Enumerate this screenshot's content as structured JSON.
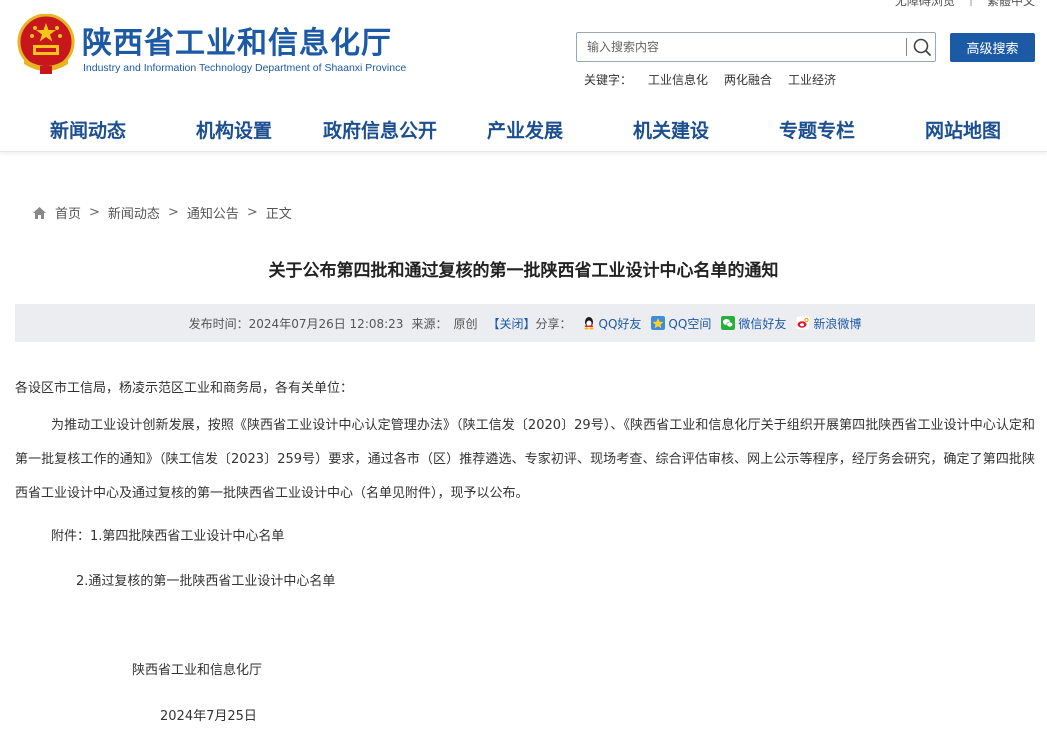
{
  "top_util": {
    "barrier_free": "无障碍浏览",
    "simplified": "繁體中文"
  },
  "site": {
    "title": "陕西省工业和信息化厅",
    "subtitle": "Industry and Information Technology Department of Shaanxi Province"
  },
  "search": {
    "placeholder": "输入搜索内容",
    "advanced_label": "高级搜索"
  },
  "keywords": {
    "label": "关键字：",
    "items": [
      "工业信息化",
      "两化融合",
      "工业经济"
    ]
  },
  "nav": {
    "items": [
      "新闻动态",
      "机构设置",
      "政府信息公开",
      "产业发展",
      "机关建设",
      "专题专栏",
      "网站地图"
    ]
  },
  "breadcrumb": {
    "items": [
      "首页",
      "新闻动态",
      "通知公告",
      "正文"
    ],
    "separator": ">"
  },
  "article": {
    "title": "关于公布第四批和通过复核的第一批陕西省工业设计中心名单的通知",
    "meta": {
      "publish_label": "发布时间：",
      "publish_time": "2024年07月26日 12:08:23",
      "source_label": "来源：",
      "source": "原创",
      "close": "【关闭】",
      "share_label": "分享：",
      "share": [
        "QQ好友",
        "QQ空间",
        "微信好友",
        "新浪微博"
      ]
    },
    "greeting": "各设区市工信局，杨凌示范区工业和商务局，各有关单位：",
    "body": "为推动工业设计创新发展，按照《陕西省工业设计中心认定管理办法》（陕工信发〔2020〕29号）、《陕西省工业和信息化厅关于组织开展第四批陕西省工业设计中心认定和第一批复核工作的通知》（陕工信发〔2023〕259号）要求，通过各市（区）推荐遴选、专家初评、现场考查、综合评估审核、网上公示等程序，经厅务会研究，确定了第四批陕西省工业设计中心及通过复核的第一批陕西省工业设计中心（名单见附件），现予以公布。",
    "attachment_1": "附件：1.第四批陕西省工业设计中心名单",
    "attachment_2": "2.通过复核的第一批陕西省工业设计中心名单",
    "org": "陕西省工业和信息化厅",
    "date": "2024年7月25日"
  },
  "colors": {
    "brand": "#1c5aa6",
    "nav_text": "#1c4f8f",
    "meta_bg": "#ebedf0"
  }
}
